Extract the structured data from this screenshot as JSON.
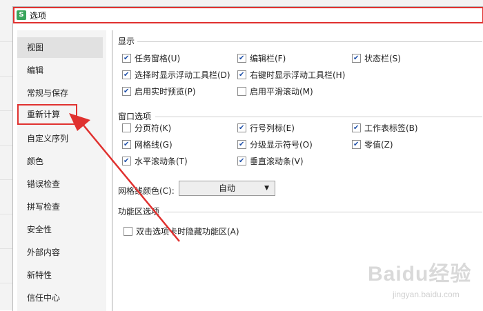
{
  "window": {
    "title": "选项",
    "icon_char": "S"
  },
  "sidebar": {
    "items": [
      {
        "label": "视图"
      },
      {
        "label": "编辑"
      },
      {
        "label": "常规与保存"
      },
      {
        "label": "重新计算"
      },
      {
        "label": "自定义序列"
      },
      {
        "label": "颜色"
      },
      {
        "label": "错误检查"
      },
      {
        "label": "拼写检查"
      },
      {
        "label": "安全性"
      },
      {
        "label": "外部内容"
      },
      {
        "label": "新特性"
      },
      {
        "label": "信任中心"
      }
    ],
    "selected": "视图",
    "highlighted": "重新计算"
  },
  "display": {
    "section_label": "显示",
    "options": [
      {
        "label": "任务窗格(U)",
        "checked": true
      },
      {
        "label": "编辑栏(F)",
        "checked": true
      },
      {
        "label": "状态栏(S)",
        "checked": true
      },
      {
        "label": "选择时显示浮动工具栏(D)",
        "checked": true
      },
      {
        "label": "右键时显示浮动工具栏(H)",
        "checked": true
      },
      {
        "label": "启用实时预览(P)",
        "checked": true
      },
      {
        "label": "启用平滑滚动(M)",
        "checked": false
      }
    ]
  },
  "window_options": {
    "section_label": "窗口选项",
    "options": [
      {
        "label": "分页符(K)",
        "checked": false
      },
      {
        "label": "行号列标(E)",
        "checked": true
      },
      {
        "label": "工作表标签(B)",
        "checked": true
      },
      {
        "label": "网格线(G)",
        "checked": true
      },
      {
        "label": "分级显示符号(O)",
        "checked": true
      },
      {
        "label": "零值(Z)",
        "checked": true
      },
      {
        "label": "水平滚动条(T)",
        "checked": true
      },
      {
        "label": "垂直滚动条(V)",
        "checked": true
      }
    ],
    "gridline_color_label": "网格线颜色(C):",
    "gridline_color_value": "自动"
  },
  "ribbon_options": {
    "section_label": "功能区选项",
    "options": [
      {
        "label": "双击选项卡时隐藏功能区(A)",
        "checked": false
      }
    ]
  },
  "watermark": {
    "main": "Baidu经验",
    "sub": "jingyan.baidu.com"
  },
  "colors": {
    "highlight_red": "#e0312f",
    "check_blue": "#1d4ea8"
  }
}
